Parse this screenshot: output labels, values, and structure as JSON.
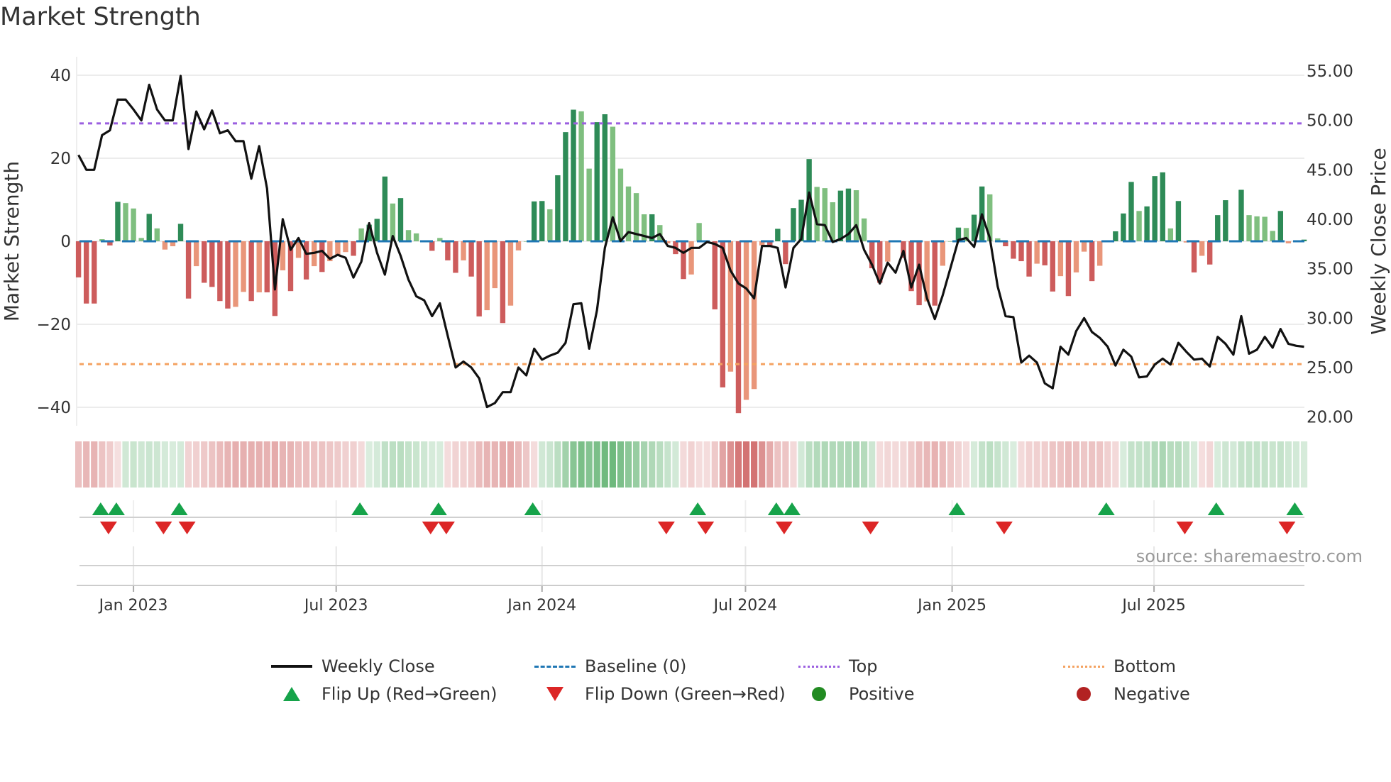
{
  "title": "Market Strength",
  "source": "source: sharemaestro.com",
  "colors": {
    "bar_pos_strong": "#2e8b57",
    "bar_pos_weak": "#7fbf7f",
    "bar_neg_strong": "#cd5c5c",
    "bar_neg_weak": "#e9967a",
    "price_line": "#111111",
    "baseline": "#1f77b4",
    "top": "#9b5fe0",
    "bottom": "#f4a261",
    "flip_up": "#16a34a",
    "flip_down": "#dc2626",
    "positive": "#228b22",
    "negative": "#b22222"
  },
  "legend": {
    "weekly_close": "Weekly Close",
    "baseline": "Baseline (0)",
    "top": "Top",
    "bottom": "Bottom",
    "flip_up": "Flip Up (Red→Green)",
    "flip_down": "Flip Down (Green→Red)",
    "positive": "Positive",
    "negative": "Negative"
  },
  "chart_data": {
    "type": "bar",
    "title": "Market Strength",
    "ylabel": "Market Strength",
    "y2label": "Weekly Close Price",
    "ylim": [
      -44,
      44
    ],
    "y2lim": [
      19,
      56.5
    ],
    "yticks": [
      40,
      20,
      0,
      -20,
      -40
    ],
    "ytick_labels": [
      "40",
      "20",
      "0",
      "−20",
      "−40"
    ],
    "y2ticks": [
      55,
      50,
      45,
      40,
      35,
      30,
      25,
      20
    ],
    "y2tick_labels": [
      "55.00",
      "50.00",
      "45.00",
      "40.00",
      "35.00",
      "30.00",
      "25.00",
      "20.00"
    ],
    "x_unit": "week index",
    "xticks": [
      7,
      32.8,
      59,
      84.9,
      111.2,
      136.9
    ],
    "xtick_labels": [
      "Jan 2023",
      "Jul 2023",
      "Jan 2024",
      "Jul 2024",
      "Jan 2025",
      "Jul 2025"
    ],
    "top_level": 28.4,
    "bottom_level": -29.6,
    "baseline": 0,
    "grid": true,
    "legend_placement": "bottom",
    "series": [
      {
        "name": "Market Strength",
        "type": "bar",
        "values": [
          -8.7,
          -15,
          -15,
          0.5,
          -1,
          9.5,
          9.2,
          7.9,
          0.8,
          6.6,
          3.1,
          -2,
          -1.2,
          4.2,
          -13.8,
          -6,
          -10,
          -11,
          -14.4,
          -16.2,
          -15.8,
          -12.2,
          -14.4,
          -12.3,
          -12.3,
          -18,
          -7,
          -12,
          -4,
          -9.2,
          -6,
          -7.4,
          -4.8,
          -3.5,
          -2.6,
          -3.5,
          3.1,
          4.0,
          5.4,
          15.6,
          9.1,
          10.4,
          2.7,
          1.9,
          0.2,
          -2.3,
          0.8,
          -4.6,
          -7.6,
          -4.6,
          -8.5,
          -18.1,
          -16.6,
          -11.3,
          -19.7,
          -15.5,
          -2.2,
          0,
          9.6,
          9.7,
          7.7,
          15.9,
          26.3,
          31.7,
          31.3,
          17.5,
          28.7,
          30.6,
          27.6,
          17.5,
          13.2,
          11.6,
          6.5,
          6.5,
          3.9,
          -0.5,
          -3.1,
          -9.1,
          -8,
          4.4,
          -0.5,
          -16.4,
          -35.2,
          -31.4,
          -41.4,
          -38.2,
          -35.6,
          -1,
          -1,
          3,
          -5.5,
          8,
          10,
          19.8,
          13.1,
          12.8,
          9.4,
          12.2,
          12.7,
          12.3,
          5.5,
          -6.5,
          -10,
          -4.9,
          0,
          -4,
          -12,
          -15.4,
          -14.5,
          -15.5,
          -5.9,
          0,
          3.3,
          3.2,
          6.4,
          13.2,
          11.3,
          0.7,
          -1.2,
          -4.2,
          -4.8,
          -8.5,
          -5.4,
          -5.8,
          -12.1,
          -8.4,
          -13.2,
          -7.5,
          -2.5,
          -9.6,
          -5.9,
          0,
          2.4,
          6.7,
          14.3,
          7.3,
          8.4,
          15.7,
          16.6,
          3.1,
          9.7,
          -0.3,
          -7.5,
          -3.5,
          -5.6,
          6.3,
          9.9,
          0,
          12.4,
          6.3,
          6,
          5.9,
          2.5,
          7.3,
          -0.5,
          0,
          0.4
        ]
      },
      {
        "name": "Weekly Close",
        "type": "line",
        "axis": "right",
        "values": [
          46.5,
          45.0,
          45.0,
          48.5,
          49.0,
          52.1,
          52.1,
          51.1,
          50.0,
          53.6,
          51.1,
          50.0,
          50.0,
          54.5,
          47.1,
          50.9,
          49.1,
          51.0,
          48.7,
          49.0,
          47.9,
          47.9,
          44.1,
          47.4,
          43.1,
          32.9,
          40.0,
          36.9,
          38.1,
          36.5,
          36.6,
          36.8,
          36.0,
          36.4,
          36.1,
          34.1,
          35.7,
          39.6,
          36.6,
          34.4,
          38.3,
          36.3,
          33.9,
          32.2,
          31.8,
          30.2,
          31.5,
          28.2,
          25.0,
          25.6,
          25.0,
          23.9,
          21.0,
          21.4,
          22.5,
          22.5,
          25.0,
          24.2,
          26.9,
          25.8,
          26.2,
          26.5,
          27.5,
          31.4,
          31.5,
          26.9,
          30.8,
          37.1,
          40.2,
          37.8,
          38.7,
          38.5,
          38.3,
          38.1,
          38.5,
          37.3,
          37.1,
          36.6,
          37.1,
          37.1,
          37.7,
          37.5,
          37.1,
          34.8,
          33.5,
          33.0,
          32.0,
          37.3,
          37.3,
          37.1,
          33.1,
          37.1,
          38.0,
          42.7,
          39.5,
          39.4,
          37.7,
          38.0,
          38.5,
          39.4,
          36.9,
          35.4,
          33.5,
          35.6,
          34.6,
          36.8,
          33.1,
          35.4,
          32.0,
          29.9,
          32.3,
          35.1,
          37.9,
          38.1,
          37.2,
          40.5,
          38.1,
          33.2,
          30.2,
          30.1,
          25.5,
          26.2,
          25.5,
          23.4,
          22.9,
          27.1,
          26.3,
          28.7,
          30.0,
          28.6,
          28.0,
          27.1,
          25.2,
          26.8,
          26.1,
          24.0,
          24.1,
          25.3,
          25.9,
          25.3,
          27.5,
          26.6,
          25.8,
          25.9,
          25.1,
          28.1,
          27.4,
          26.3,
          30.2,
          26.4,
          26.8,
          28.1,
          27.0,
          28.9,
          27.4,
          27.2,
          27.1
        ]
      }
    ],
    "flip_up_weeks": [
      3,
      5,
      13,
      36,
      46,
      58,
      79,
      89,
      91,
      112,
      131,
      145,
      155
    ],
    "flip_down_weeks": [
      4,
      11,
      14,
      45,
      47,
      75,
      80,
      90,
      101,
      118,
      141,
      154
    ]
  }
}
